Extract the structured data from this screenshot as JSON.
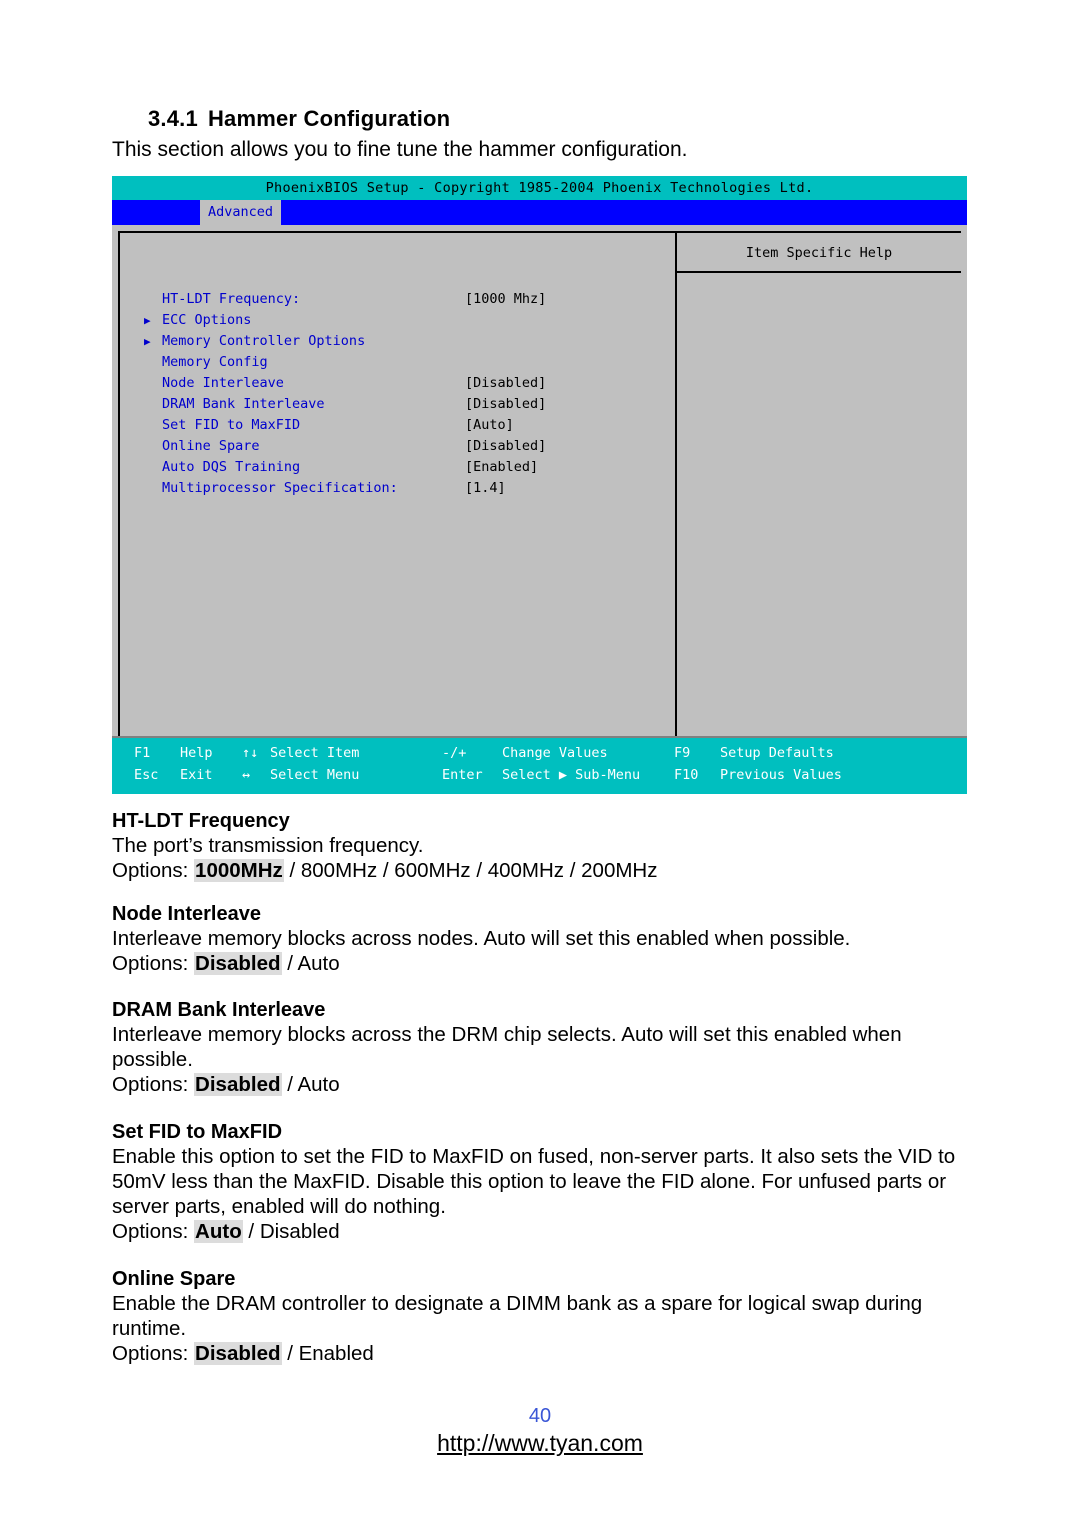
{
  "document": {
    "section_number": "3.4.1",
    "section_title": "Hammer Configuration",
    "intro": "This section allows you to fine tune the hammer configuration.",
    "page_number": "40",
    "url": "http://www.tyan.com"
  },
  "bios": {
    "title_bar": "PhoenixBIOS Setup - Copyright 1985-2004 Phoenix Technologies Ltd.",
    "active_tab": "Advanced",
    "help_panel_title": "Item Specific Help",
    "menu_items": [
      {
        "arrow": "",
        "label": "HT-LDT Frequency:",
        "value": "[1000 Mhz]"
      },
      {
        "arrow": "▶",
        "label": "ECC Options",
        "value": ""
      },
      {
        "arrow": "▶",
        "label": "Memory Controller Options",
        "value": ""
      },
      {
        "arrow": "",
        "label": "Memory Config",
        "value": ""
      },
      {
        "arrow": "",
        "label": "Node Interleave",
        "value": "[Disabled]"
      },
      {
        "arrow": "",
        "label": "DRAM Bank Interleave",
        "value": "[Disabled]"
      },
      {
        "arrow": "",
        "label": "Set FID to MaxFID",
        "value": "[Auto]"
      },
      {
        "arrow": "",
        "label": "Online Spare",
        "value": "[Disabled]"
      },
      {
        "arrow": "",
        "label": "Auto DQS Training",
        "value": "[Enabled]"
      },
      {
        "arrow": "",
        "label": "Multiprocessor Specification:",
        "value": "[1.4]"
      }
    ],
    "function_keys": {
      "row1": [
        {
          "key": "F1",
          "action": "Help"
        },
        {
          "key": "↑↓",
          "action": "Select Item"
        },
        {
          "key": "-/+",
          "action": "Change Values"
        },
        {
          "key": "F9",
          "action": "Setup Defaults"
        }
      ],
      "row2": [
        {
          "key": "Esc",
          "action": "Exit"
        },
        {
          "key": "↔",
          "action": "Select Menu"
        },
        {
          "key": "Enter",
          "action": "Select ▶ Sub-Menu"
        },
        {
          "key": "F10",
          "action": "Previous Values"
        }
      ]
    },
    "colors": {
      "title_bar_bg": "#00bfbf",
      "menu_bar_bg": "#0000ff",
      "panel_bg": "#c0c0c0",
      "menu_text": "#0000cd",
      "footer_bg": "#00bfbf"
    }
  },
  "settings": [
    {
      "heading": "HT-LDT Frequency",
      "description": "The port’s transmission frequency.",
      "options_label": "Options: ",
      "default_option": "1000MHz",
      "other_options": " / 800MHz / 600MHz / 400MHz / 200MHz"
    },
    {
      "heading": "Node Interleave",
      "description": "Interleave memory blocks across nodes.  Auto will set this enabled when possible.",
      "options_label": "Options: ",
      "default_option": "Disabled",
      "other_options": " / Auto"
    },
    {
      "heading": "DRAM Bank Interleave",
      "description": "Interleave memory blocks across the DRM chip selects.  Auto will set this enabled when possible.",
      "options_label": "Options: ",
      "default_option": "Disabled",
      "other_options": " / Auto"
    },
    {
      "heading": "Set FID to MaxFID",
      "description": "Enable this option to set the FID to MaxFID on fused, non-server parts.  It also sets the VID to 50mV less than the MaxFID.  Disable this option to leave the FID alone.  For unfused parts or server parts, enabled will do nothing.",
      "options_label": "Options: ",
      "default_option": "Auto",
      "other_options": " / Disabled"
    },
    {
      "heading": "Online Spare",
      "description": "Enable the DRAM controller to designate a DIMM bank as a spare for logical swap during runtime.",
      "options_label": "Options: ",
      "default_option": "Disabled",
      "other_options": " / Enabled"
    }
  ]
}
